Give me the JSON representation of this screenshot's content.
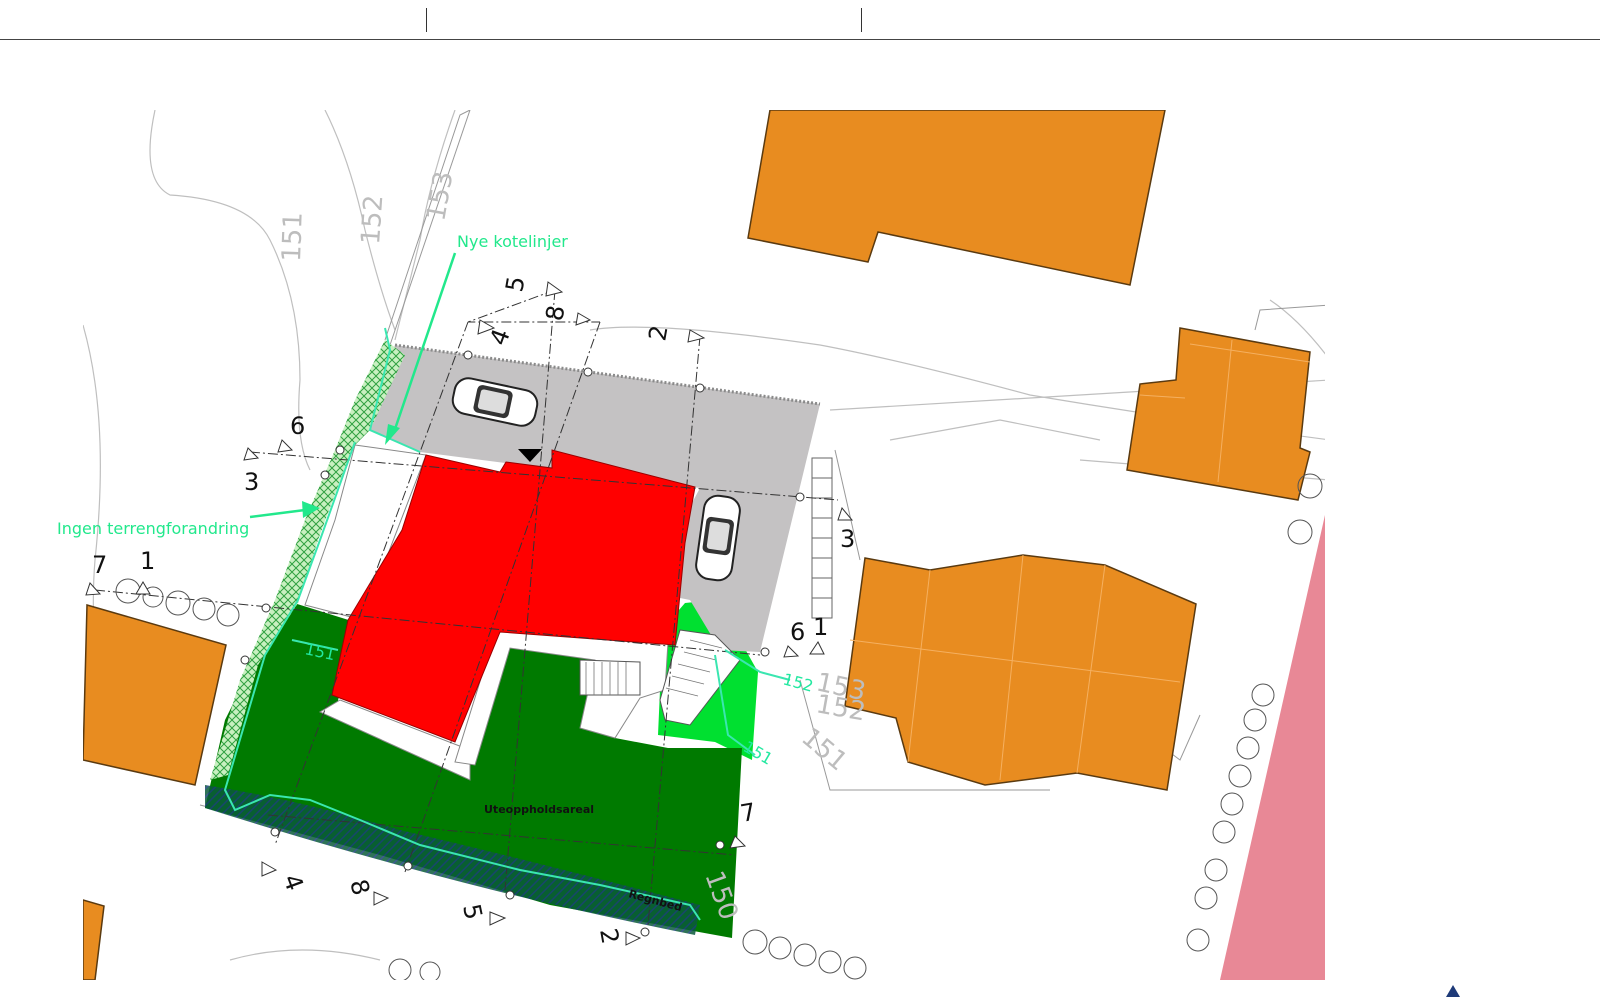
{
  "colors": {
    "building_existing": "#e88c20",
    "building_new": "#ff0000",
    "parking": "#c4c2c3",
    "outdoor_area": "#007a00",
    "light_green": "#00e030",
    "annotation": "#22e88c",
    "road_zone": "#e88896",
    "contour": "#bfbfbf"
  },
  "annotations": {
    "new_contours": "Nye kotelinjer",
    "no_terrain_change": "Ingen terrengforandring"
  },
  "areas": {
    "outdoor": "Uteoppholdsareal",
    "rain_bed": "Regnbed"
  },
  "contour_labels": {
    "c151_left": "151",
    "c152_left": "152",
    "c153_left": "153",
    "c153_right": "153",
    "c152_right": "152",
    "c151_right": "151",
    "c150": "150"
  },
  "new_contour_labels": {
    "n151_left": "151",
    "n152": "152",
    "n151_right": "151"
  },
  "sections": {
    "s5_top": "5",
    "s8_top": "8",
    "s4_top": "4",
    "s2_top": "2",
    "s6_left": "6",
    "s3_left": "3",
    "s7_left": "7",
    "s1_left": "1",
    "s3_right": "3",
    "s6_right": "6",
    "s1_right": "1",
    "s7_right": "7",
    "s4_bottom": "4",
    "s8_bottom": "8",
    "s5_bottom": "5",
    "s2_bottom": "2"
  }
}
